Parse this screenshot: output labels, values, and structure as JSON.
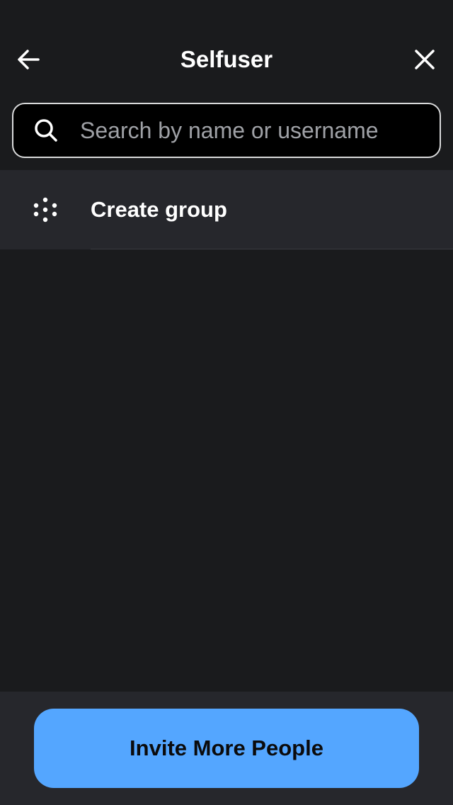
{
  "header": {
    "title": "Selfuser",
    "back_icon": "arrow-left-icon",
    "close_icon": "close-icon"
  },
  "search": {
    "placeholder": "Search by name or username",
    "value": "",
    "icon": "search-icon"
  },
  "list": {
    "items": [
      {
        "label": "Create group",
        "icon": "group-icon"
      }
    ]
  },
  "footer": {
    "invite_label": "Invite More People"
  },
  "colors": {
    "background": "#1a1b1d",
    "row_background": "#26272c",
    "accent": "#54a6ff",
    "search_border": "#d9dadb",
    "placeholder": "#9fa1a6"
  }
}
